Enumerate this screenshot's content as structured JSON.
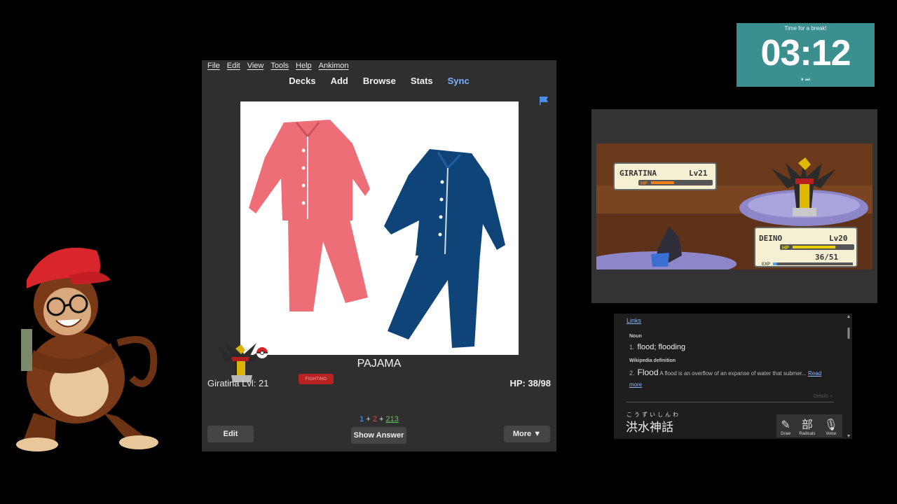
{
  "anki": {
    "menu": [
      "File",
      "Edit",
      "View",
      "Tools",
      "Help",
      "Ankimon"
    ],
    "toolbar": {
      "decks": "Decks",
      "add": "Add",
      "browse": "Browse",
      "stats": "Stats",
      "sync": "Sync"
    },
    "card": {
      "word": "PAJAMA",
      "image": "pajamas-icon"
    },
    "pokemon": {
      "name": "Giratina Lvl: 21",
      "type": "FIGHTING",
      "hp": "HP: 38/98"
    },
    "counts": {
      "new": "1",
      "plus1": "+",
      "learn": "2",
      "plus2": "+",
      "review": "213"
    },
    "buttons": {
      "edit": "Edit",
      "show_answer": "Show Answer",
      "more": "More ▼"
    },
    "colors": {
      "new": "#4a9cf5",
      "learn": "#e04848",
      "review": "#5cc05c",
      "sync": "#7fb0ff"
    }
  },
  "timer": {
    "label": "Time for a break!",
    "time": "03:12",
    "controls": "⏸ ⏭"
  },
  "game": {
    "enemy": {
      "name": "GIRATINA",
      "level": "Lv21",
      "hp_label": "HP",
      "hp_fraction": 0.38
    },
    "player": {
      "name": "DEINO",
      "level": "Lv20",
      "hp_label": "HP",
      "hp_text": "36/51",
      "hp_fraction": 0.71,
      "exp_label": "EXP",
      "exp_fraction": 0.05
    }
  },
  "dictionary": {
    "links": "Links",
    "noun_label": "Noun",
    "def1_num": "1.",
    "def1": "flood; flooding",
    "wiki_label": "Wikipedia definition",
    "def2_num": "2.",
    "def2_word": "Flood",
    "def2_text": "A flood is an overflow of an expanse of water that submer...",
    "read_more_1": "Read",
    "read_more_2": "more",
    "details": "Details »",
    "furigana": "こうずいしんわ",
    "kanji": "洪水神話",
    "tools": [
      "Draw",
      "Radicals",
      "Voice"
    ],
    "tool_icons": [
      "pencil-icon",
      "radical-icon",
      "microphone-icon"
    ]
  }
}
